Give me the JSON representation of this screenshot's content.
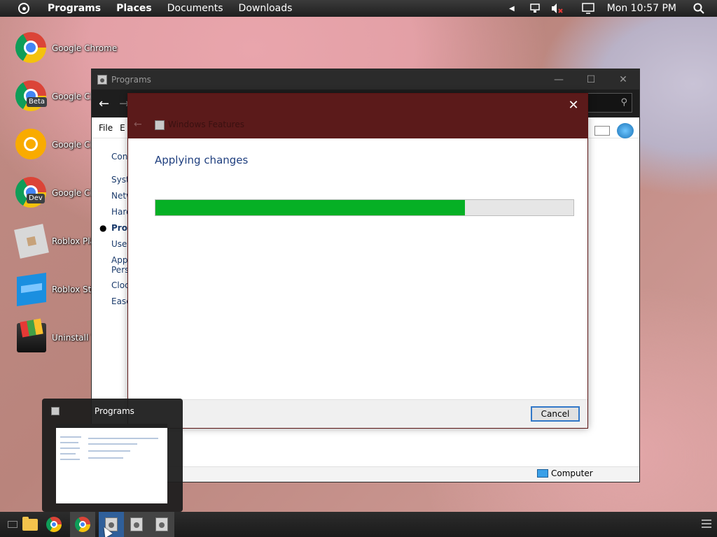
{
  "top_panel": {
    "items": [
      "Programs",
      "Places",
      "Documents",
      "Downloads"
    ],
    "clock": "Mon 10:57 PM",
    "icons": [
      "activities-icon",
      "arrow-left-icon",
      "network-icon",
      "volume-muted-icon",
      "display-icon",
      "search-icon"
    ]
  },
  "desktop_icons": [
    {
      "label": "Google Chrome",
      "icon": "chrome-icon"
    },
    {
      "label": "Google Ch",
      "icon": "chrome-beta-icon",
      "badge": "Beta"
    },
    {
      "label": "Google Ch",
      "icon": "chrome-canary-icon"
    },
    {
      "label": "Google Ch",
      "icon": "chrome-dev-icon",
      "badge": "Dev"
    },
    {
      "label": "Roblox Pla",
      "icon": "roblox-player-icon"
    },
    {
      "label": "Roblox Stu",
      "icon": "roblox-studio-icon"
    },
    {
      "label": "Uninstall T",
      "icon": "uninstall-tool-icon"
    }
  ],
  "programs_window": {
    "title": "Programs",
    "menu": [
      "File",
      "E"
    ],
    "sidebar": [
      "Con",
      "Syst",
      "Netw",
      "Hard",
      "Prog",
      "User",
      "App",
      "Pers",
      "Cloc",
      "Ease"
    ],
    "selected_sidebar": "Prog",
    "right_fragment": "s",
    "status_computer": "Computer"
  },
  "features_dialog": {
    "title": "Windows Features",
    "heading": "Applying changes",
    "progress": 0.74,
    "cancel_label": "Cancel",
    "progress_color": "#06b025",
    "header_color": "#5b1a1a"
  },
  "taskbar_preview": {
    "title": "Programs"
  },
  "taskbar": {
    "items": [
      "show-desktop-icon",
      "file-manager-icon",
      "chrome-icon",
      "chrome-icon",
      "control-panel-icon",
      "control-panel-icon",
      "control-panel-icon",
      "menu-icon"
    ]
  }
}
